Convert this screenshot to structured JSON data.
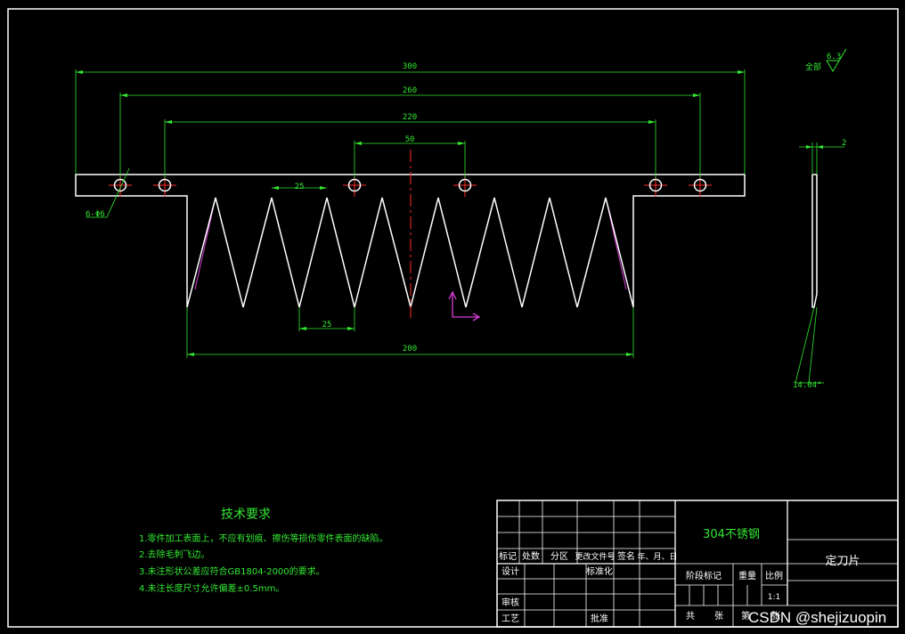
{
  "dimensions": {
    "overall_length": "300",
    "outer_hole_span": "260",
    "inner_hole_span": "220",
    "center_hole_span": "50",
    "tooth_pitch_top": "25",
    "tooth_pitch_bottom": "25",
    "toothed_length": "200",
    "hole_callout": "6-Φ6",
    "thickness": "2",
    "edge_angle": "14.04°"
  },
  "surface_finish": {
    "label": "全部",
    "value": "6.3"
  },
  "tech_requirements": {
    "title": "技术要求",
    "items": [
      "1.零件加工表面上，不应有划痕、擦伤等损伤零件表面的缺陷。",
      "2.去除毛刺飞边。",
      "3.未注形状公差应符合GB1804-2000的要求。",
      "4.未注长度尺寸允许偏差±0.5mm。"
    ]
  },
  "title_block": {
    "material": "304不锈钢",
    "part_name": "定刀片",
    "headers": [
      "标记",
      "处数",
      "分区",
      "更改文件号",
      "签名",
      "年、月、日"
    ],
    "rows": [
      "设计",
      "审核",
      "工艺"
    ],
    "standardization": "标准化",
    "approval": "批准",
    "stage_mark": "阶段标记",
    "weight": "重量",
    "scale_label": "比例",
    "scale_value": "1:1",
    "sheets_total": "共",
    "sheets_unit": "张",
    "sheet_no": "第",
    "sheet_unit2": "张"
  },
  "watermark": "CSDN @shejizuopin",
  "colors": {
    "background": "#000000",
    "outline": "#ffffff",
    "dimension": "#33e833",
    "centerline": "#ff2a2a",
    "phantom": "#d63cd6"
  }
}
